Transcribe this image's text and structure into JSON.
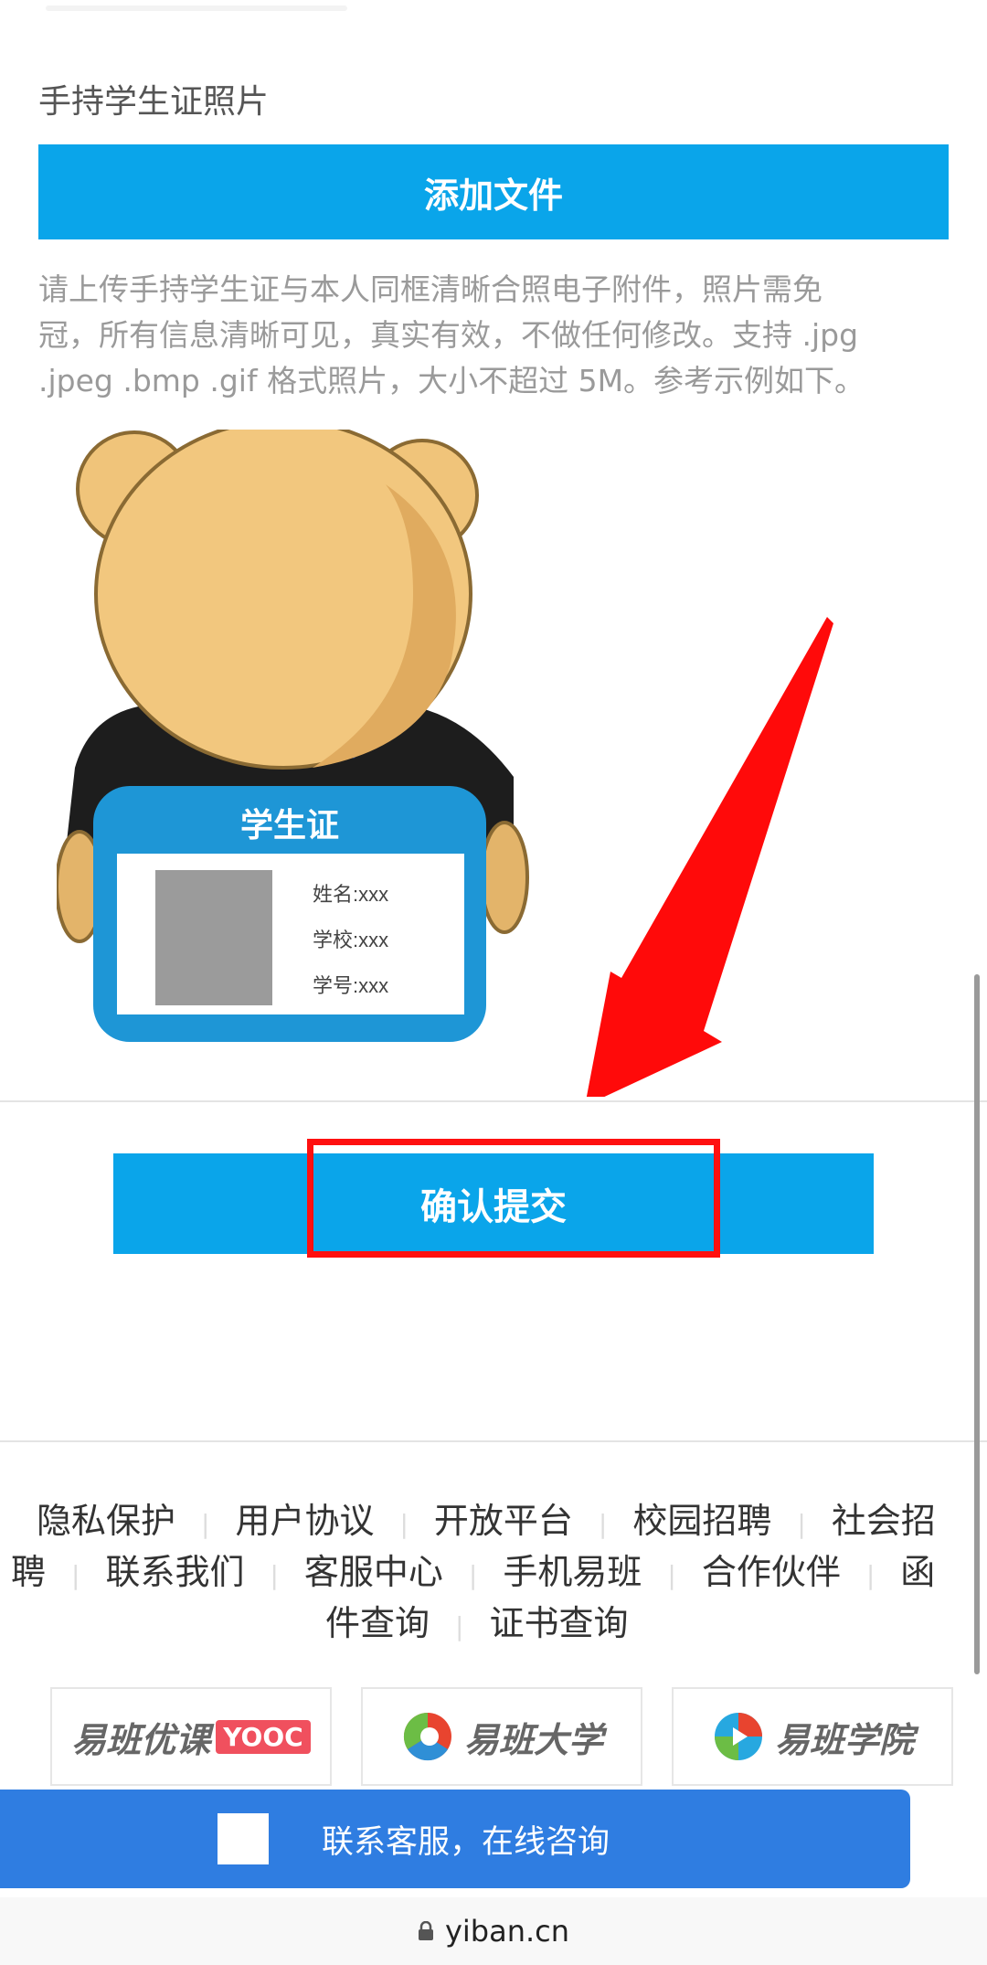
{
  "section": {
    "title": "手持学生证照片",
    "add_file_label": "添加文件",
    "hint_lines": [
      "请上传手持学生证与本人同框清晰合照电子附件，照片需免",
      "冠，所有信息清晰可见，真实有效，不做任何修改。支持 .jpg",
      ".jpeg .bmp .gif 格式照片，大小不超过 5M。参考示例如下。"
    ]
  },
  "example_card": {
    "title": "学生证",
    "name_line": "姓名:xxx",
    "school_line": "学校:xxx",
    "id_line": "学号:xxx"
  },
  "confirm": {
    "label": "确认提交"
  },
  "footer": {
    "links_row1": [
      "隐私保护",
      "用户协议",
      "开放平台",
      "校园招聘",
      "社会招"
    ],
    "links_row2": [
      "聘",
      "联系我们",
      "客服中心",
      "手机易班",
      "合作伙伴",
      "函"
    ],
    "links_row3": [
      "件查询",
      "证书查询"
    ],
    "partners": [
      {
        "name": "易班优课",
        "badge": "YOOC"
      },
      {
        "name": "易班大学"
      },
      {
        "name": "易班学院"
      }
    ]
  },
  "service_bar": {
    "text": "联系客服，在线咨询"
  },
  "address_bar": {
    "url": "yiban.cn"
  },
  "colors": {
    "button_blue": "#0aa5ea",
    "service_blue": "#2f7de1",
    "highlight_red": "#ff1010"
  }
}
